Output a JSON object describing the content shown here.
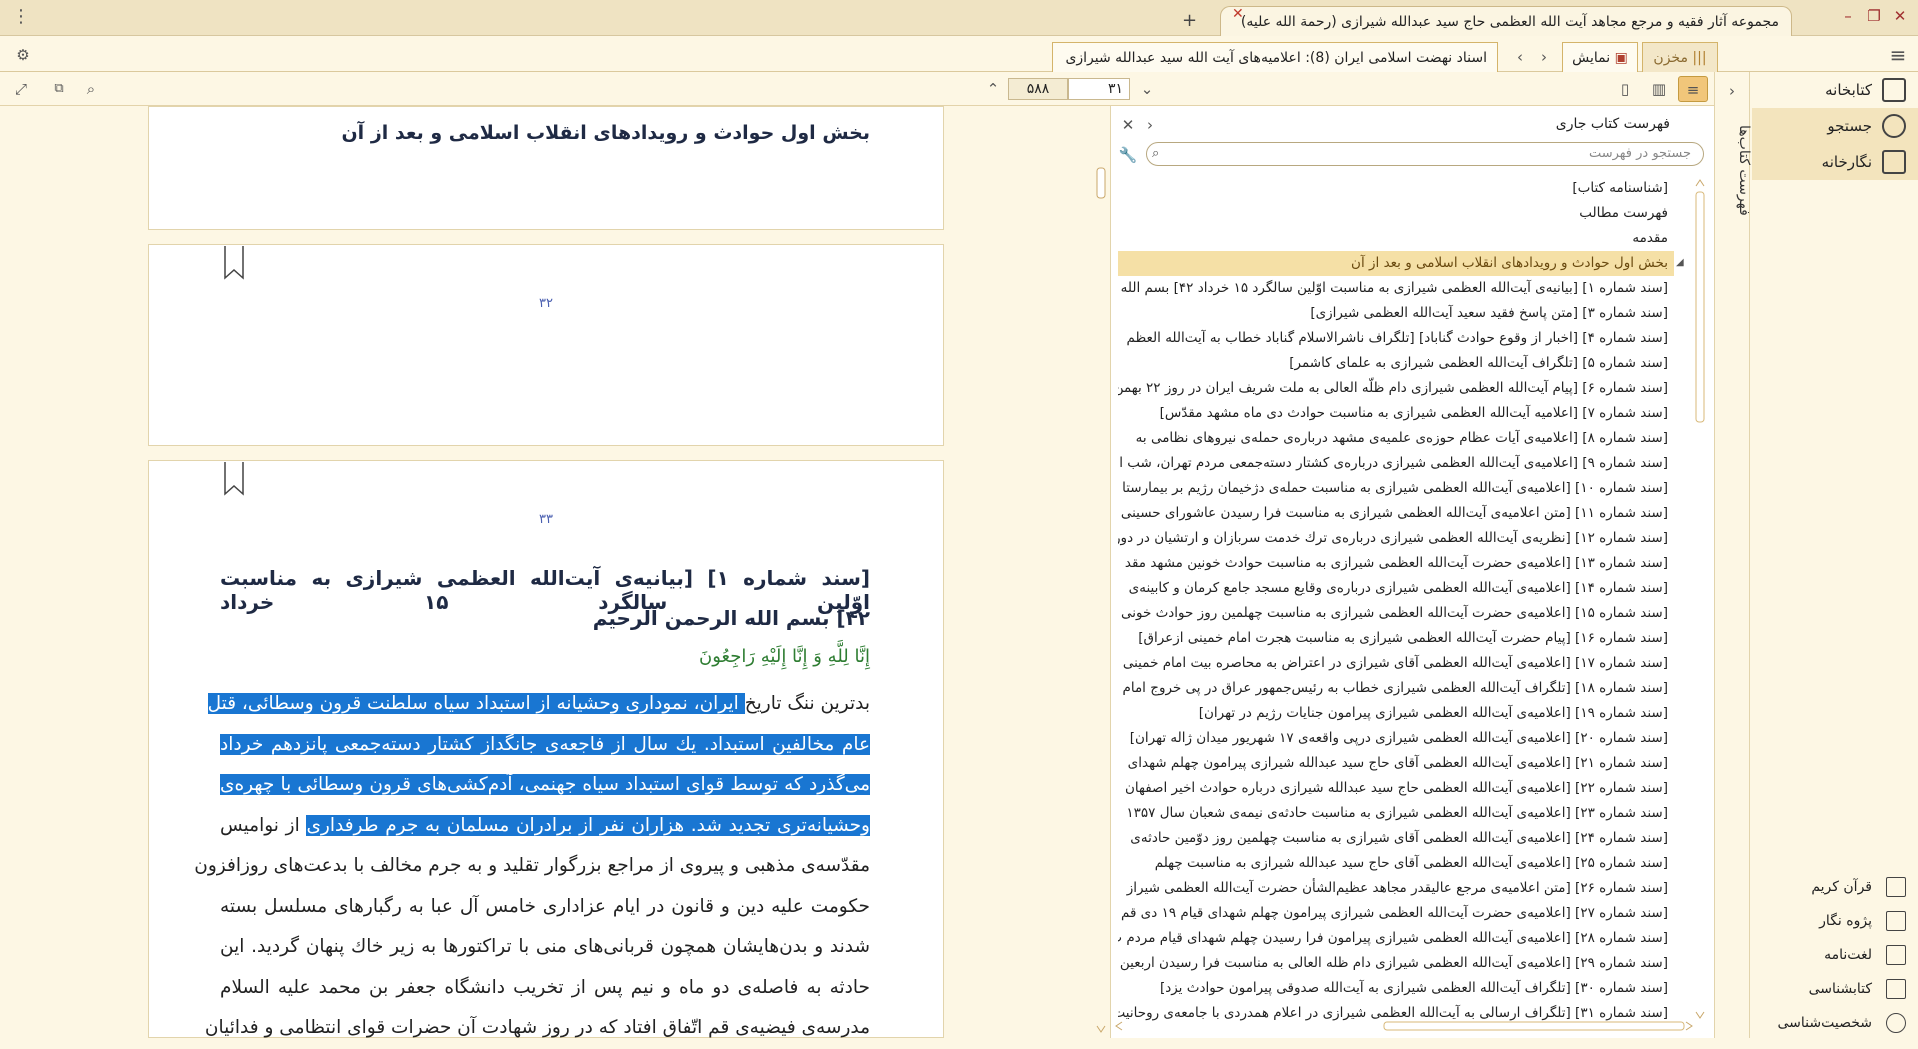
{
  "window": {
    "title": "مجموعه آثار فقیه و مرجع مجاهد آیت الله العظمی حاج سید عبدالله شیرازی (رحمة الله علیه)",
    "controls": {
      "minimize": "–",
      "restore": "❐",
      "close": "✕"
    }
  },
  "tabs": {
    "document_tab": "اسناد نهضت اسلامی ایران (8): اعلامیه‌های آیت الله سید عبدالله شیرازی",
    "display_tab": "نمایش",
    "store_tab": "مخزن"
  },
  "toolbar": {
    "page_current": "۳۱",
    "page_total": "۵۸۸"
  },
  "document": {
    "heading": "بخش اول حوادث و رویدادهای انقلاب اسلامی و بعد از آن",
    "page_numbers": [
      "۳۲",
      "۳۳"
    ],
    "title_lines": [
      "[سند شماره ۱] [بیانیه‌ی آیت‌الله العظمی شیرازی به مناسبت اوّلین سالگرد ۱۵ خرداد",
      "۴۲] بسم الله الرحمن الرحیم"
    ],
    "verse": "إِنَّا لِلَّهِ وَ إِنَّا إِلَيْهِ رَاجِعُونَ",
    "lines": [
      {
        "pre": "بدترین ننگ تاریخ",
        "hl": " ایران، نموداری وحشیانه از استبداد سیاه سلطنت قرون وسطائی، قتل",
        "post": ""
      },
      {
        "pre": "",
        "hl": "عام مخالفین استبداد. یك سال از فاجعه‌ی جانگداز کشتار دسته‌جمعی پانزدهم خرداد",
        "post": ""
      },
      {
        "pre": "",
        "hl": "می‌گذرد که توسط قوای استبداد سیاه جهنمی، آدم‌کشی‌های قرون وسطائی با چهره‌ی",
        "post": ""
      },
      {
        "pre": "",
        "hl": "وحشیانه‌تری تجدید شد. هزاران نفر از برادران مسلمان به جرم طرفداری",
        "post": " از نوامیس"
      },
      {
        "pre": "مقدّسه‌ی مذهبی و پیروی از مراجع بزرگوار تقلید و به جرم مخالف با بدعت‌های روزافزون",
        "hl": "",
        "post": ""
      },
      {
        "pre": "حکومت علیه دین و قانون در ایام عزاداری خامس آل عبا به رگبارهای مسلسل بسته",
        "hl": "",
        "post": ""
      },
      {
        "pre": "شدند و بدن‌هایشان همچون قربانی‌های منی با تراکتورها به زیر خاك پنهان گردید. این",
        "hl": "",
        "post": ""
      },
      {
        "pre": "حادثه به فاصله‌ی دو ماه و نیم پس از تخریب دانشگاه جعفر بن محمد علیه السلام",
        "hl": "",
        "post": ""
      },
      {
        "pre": "مدرسه‌ی فیضیه‌ی قم اتّفاق افتاد که در روز شهادت آن حضرات قوای انتظامی و فدائیان",
        "hl": "",
        "post": ""
      }
    ]
  },
  "toc": {
    "title": "فهرست کتاب جاری",
    "search_placeholder": "جستجو در فهرست",
    "items": [
      "[شناسنامه کتاب]",
      "فهرست مطالب",
      "مقدمه",
      "بخش اول حوادث و رویدادهای انقلاب اسلامی و بعد از آن",
      "[سند شماره ۱] [بیانیه‌ی آیت‌الله العظمی شیرازی به مناسبت اوّلین سالگرد ۱۵ خرداد ۴۲] بسم الله",
      "[سند شماره ۳] [متن پاسخ فقید سعید آیت‌الله العظمی شیرازی]",
      "[سند شماره ۴] [اخبار از وقوع حوادث گناباد] [تلگراف ناشرالاسلام گناباد خطاب به آیت‌الله العظم",
      "[سند شماره ۵] [تلگراف آیت‌الله العظمی شیرازی به علمای کاشمر]",
      "[سند شماره ۶] [پیام آیت‌الله العظمی شیرازی دام ظلّه العالی به ملت شریف ایران در روز ۲۲ بهمن",
      "[سند شماره ۷] [اعلامیه آیت‌الله العظمی شیرازی به مناسبت حوادث دی ماه مشهد مقدّس]",
      "[سند شماره ۸] [اعلامیه‌ی آیات عظام حوزه‌ی علمیه‌ی مشهد درباره‌ی حمله‌ی نیروهای نظامی به",
      "[سند شماره ۹] [اعلامیه‌ی آیت‌الله العظمی شیرازی درباره‌ی کشتار دسته‌جمعی مردم تهران، شب ا",
      "[سند شماره ۱۰] [اعلامیه‌ی آیت‌الله العظمی شیرازی به مناسبت حمله‌ی دژخیمان رژیم بر بیمارستا",
      "[سند شماره ۱۱] [متن اعلامیه‌ی آیت‌الله العظمی شیرازی به مناسبت فرا رسیدن عاشورای حسینی",
      "[سند شماره ۱۲] [نظریه‌ی آیت‌الله العظمی شیرازی درباره‌ی ترك خدمت سربازان و ارتشیان در دورا",
      "[سند شماره ۱۳] [اعلامیه‌ی حضرت آیت‌الله العظمی شیرازی به مناسبت حوادث خونین مشهد مقد",
      "[سند شماره ۱۴] [اعلامیه‌ی آیت‌الله العظمی شیرازی درباره‌ی وقایع مسجد جامع کرمان و کابینه‌ی",
      "[سند شماره ۱۵] [اعلامیه‌ی حضرت آیت‌الله العظمی شیرازی به مناسبت چهلمین روز حوادث خونی",
      "[سند شماره ۱۶] [پیام حضرت آیت‌الله العظمی شیرازی به مناسبت هجرت امام خمینی ازعراق]",
      "[سند شماره ۱۷] [اعلامیه‌ی آیت‌الله العظمی آقای شیرازی در اعتراض به محاصره بیت امام خمینی",
      "[سند شماره ۱۸] [تلگراف آیت‌الله العظمی شیرازی خطاب به رئیس‌جمهور عراق در پی خروج امام ا",
      "[سند شماره ۱۹] [اعلامیه‌ی آیت‌الله العظمی شیرازی پیرامون جنایات رژیم در تهران]",
      "[سند شماره ۲۰] [اعلامیه‌ی آیت‌الله العظمی شیرازی درپی واقعه‌ی ۱۷ شهریور میدان ژاله تهران]",
      "[سند شماره ۲۱] [اعلامیه‌ی آیت‌الله العظمی آقای حاج سید عبدالله شیرازی پیرامون چهلم شهدای",
      "[سند شماره ۲۲] [اعلامیه‌ی آیت‌الله العظمی حاج سید عبدالله شیرازی درباره حوادث اخیر اصفهان",
      "[سند شماره ۲۳] [اعلامیه‌ی آیت‌الله العظمی شیرازی به مناسبت حادثه‌ی نیمه‌ی شعبان سال ۱۳۵۷",
      "[سند شماره ۲۴] [اعلامیه‌ی آیت‌الله العظمی آقای شیرازی به مناسبت چهلمین روز دوّمین حادثه‌ی",
      "[سند شماره ۲۵] [اعلامیه‌ی آیت‌الله العظمی آقای حاج سید عبدالله شیرازی به مناسبت چهلم",
      "[سند شماره ۲۶] [متن اعلامیه‌ی مرجع عالیقدر مجاهد عظیم‌الشأن حضرت آیت‌الله العظمی شیراز",
      "[سند شماره ۲۷] [اعلامیه‌ی حضرت آیت‌الله العظمی شیرازی پیرامون چهلم شهدای قیام ۱۹ دی قم",
      "[سند شماره ۲۸] [اعلامیه‌ی آیت‌الله العظمی شیرازی پیرامون فرا رسیدن چهلم شهدای قیام مردم ت",
      "[سند شماره ۲۹] [اعلامیه‌ی آیت‌الله العظمی شیرازی دام ظله العالی به مناسبت فرا رسیدن اربعین ح",
      "[سند شماره ۳۰] [تلگراف آیت‌الله العظمی شیرازی به آیت‌الله صدوقی پیرامون حوادث یزد]",
      "[سند شماره ۳۱] [تلگراف ارسالی به آیت‌الله العظمی شیرازی در اعلام همدردی با جامعه‌ی روحانیت"
    ]
  },
  "sidebar": {
    "vertical_label": "فهرست کتاب‌ها",
    "items": [
      "کتابخانه",
      "جستجو",
      "نگارخانه"
    ],
    "bottom_items": [
      "قرآن کریم",
      "پژوه نگار",
      "لغت‌نامه",
      "کتابشناسی",
      "شخصیت‌شناسی"
    ]
  },
  "colors": {
    "background": "#fdf7e4",
    "highlight": "#1976d2",
    "toc_selected": "#f5e0a6",
    "page_number": "#4a5fb0",
    "verse": "#2e7d32"
  }
}
